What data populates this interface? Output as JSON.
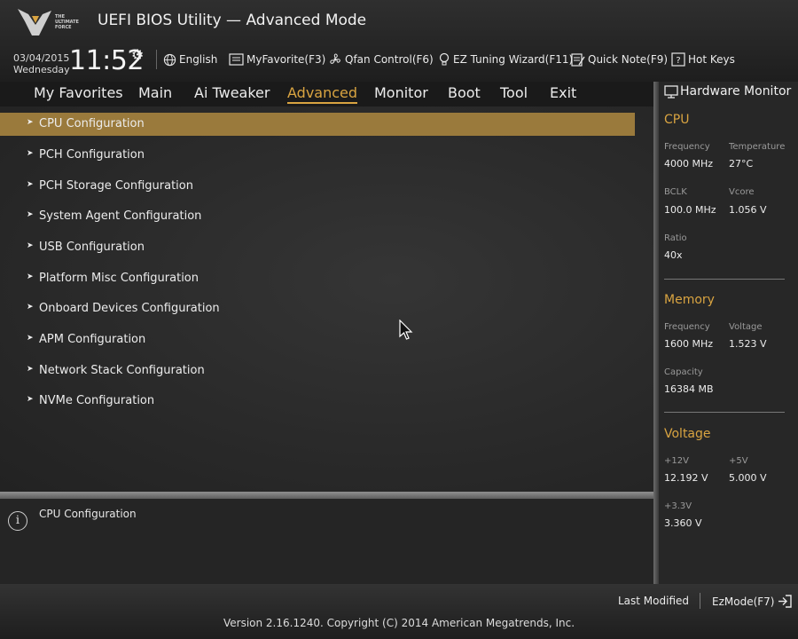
{
  "header": {
    "logo_text": [
      "THE",
      "ULTIMATE",
      "FORCE"
    ],
    "title": "UEFI BIOS Utility — Advanced Mode",
    "date": "03/04/2015",
    "weekday": "Wednesday",
    "time": "11:52"
  },
  "toolbar": {
    "language": "English",
    "myfavorite": "MyFavorite(F3)",
    "qfan": "Qfan Control(F6)",
    "ez_tuning": "EZ Tuning Wizard(F11)",
    "quick_note": "Quick Note(F9)",
    "hot_keys": "Hot Keys"
  },
  "tabs": [
    {
      "label": "My Favorites"
    },
    {
      "label": "Main"
    },
    {
      "label": "Ai Tweaker"
    },
    {
      "label": "Advanced",
      "active": true
    },
    {
      "label": "Monitor"
    },
    {
      "label": "Boot"
    },
    {
      "label": "Tool"
    },
    {
      "label": "Exit"
    }
  ],
  "menu": [
    {
      "label": "CPU Configuration",
      "selected": true
    },
    {
      "label": "PCH Configuration"
    },
    {
      "label": "PCH Storage Configuration"
    },
    {
      "label": "System Agent Configuration"
    },
    {
      "label": "USB Configuration"
    },
    {
      "label": "Platform Misc Configuration"
    },
    {
      "label": "Onboard Devices Configuration"
    },
    {
      "label": "APM Configuration"
    },
    {
      "label": "Network Stack Configuration"
    },
    {
      "label": "NVMe Configuration"
    }
  ],
  "help": {
    "text": "CPU Configuration"
  },
  "hw_monitor": {
    "title": "Hardware Monitor",
    "cpu": {
      "heading": "CPU",
      "frequency_label": "Frequency",
      "frequency": "4000 MHz",
      "temperature_label": "Temperature",
      "temperature": "27°C",
      "bclk_label": "BCLK",
      "bclk": "100.0 MHz",
      "vcore_label": "Vcore",
      "vcore": "1.056 V",
      "ratio_label": "Ratio",
      "ratio": "40x"
    },
    "memory": {
      "heading": "Memory",
      "frequency_label": "Frequency",
      "frequency": "1600 MHz",
      "voltage_label": "Voltage",
      "voltage": "1.523 V",
      "capacity_label": "Capacity",
      "capacity": "16384 MB"
    },
    "voltage": {
      "heading": "Voltage",
      "v12_label": "+12V",
      "v12": "12.192 V",
      "v5_label": "+5V",
      "v5": "5.000 V",
      "v33_label": "+3.3V",
      "v33": "3.360 V"
    }
  },
  "footer": {
    "last_modified": "Last Modified",
    "ezmode": "EzMode(F7)",
    "version": "Version 2.16.1240. Copyright (C) 2014 American Megatrends, Inc."
  },
  "colors": {
    "accent": "#d9a441",
    "selection": "#9a7a3c"
  }
}
